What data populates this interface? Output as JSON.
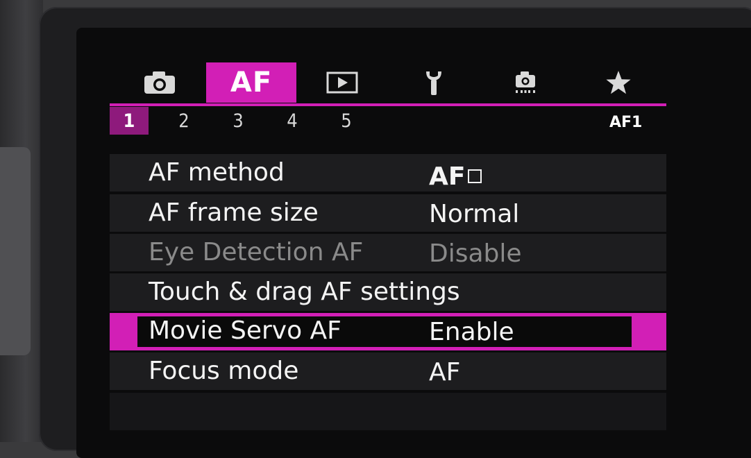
{
  "tabs": [
    {
      "id": "shooting",
      "icon": "camera-icon",
      "label": ""
    },
    {
      "id": "af",
      "icon": "",
      "label": "AF"
    },
    {
      "id": "playback",
      "icon": "play-icon",
      "label": ""
    },
    {
      "id": "setup",
      "icon": "wrench-icon",
      "label": ""
    },
    {
      "id": "custom",
      "icon": "custom-functions-icon",
      "label": ""
    },
    {
      "id": "mymenu",
      "icon": "star-icon",
      "label": ""
    }
  ],
  "active_tab": "af",
  "subtabs": [
    "1",
    "2",
    "3",
    "4",
    "5"
  ],
  "active_subtab": "1",
  "page_code": "AF1",
  "menu": [
    {
      "label": "AF method",
      "value": "AF",
      "value_icon": "af-frame-icon",
      "state": "normal"
    },
    {
      "label": "AF frame size",
      "value": "Normal",
      "state": "normal"
    },
    {
      "label": "Eye Detection AF",
      "value": "Disable",
      "state": "disabled"
    },
    {
      "label": "Touch & drag AF settings",
      "value": "",
      "state": "normal"
    },
    {
      "label": "Movie Servo AF",
      "value": "Enable",
      "state": "selected"
    },
    {
      "label": "Focus mode",
      "value": "AF",
      "state": "normal"
    }
  ],
  "colors": {
    "accent": "#d21fb6",
    "subtab_active": "#8e1a7c",
    "text": "#f4f4f4",
    "disabled_text": "#8a8a8a",
    "row_bg": "#1d1d1f",
    "screen_bg": "#0b0b0c"
  }
}
